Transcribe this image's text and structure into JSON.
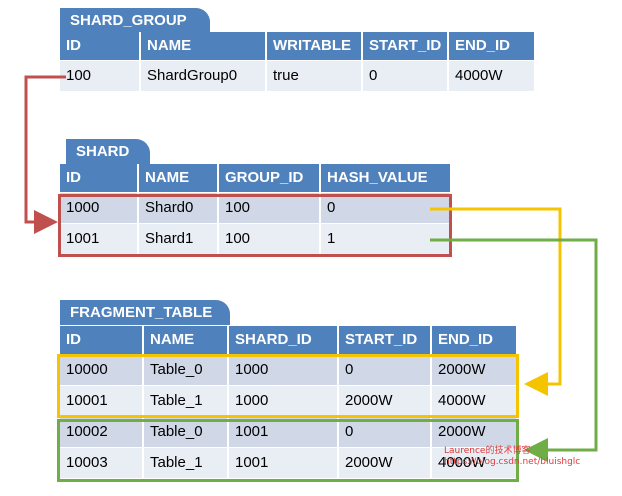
{
  "colors": {
    "header_blue": "#4f81bd",
    "row_dark": "#d0d8e8",
    "row_light": "#e9edf4",
    "red_link": "#c0504d",
    "yellow_link": "#f5c400",
    "green_link": "#70ad47"
  },
  "shard_group": {
    "title": "SHARD_GROUP",
    "columns": [
      "ID",
      "NAME",
      "WRITABLE",
      "START_ID",
      "END_ID"
    ],
    "rows": [
      [
        "100",
        "ShardGroup0",
        "true",
        "0",
        "4000W"
      ]
    ]
  },
  "shard": {
    "title": "SHARD",
    "columns": [
      "ID",
      "NAME",
      "GROUP_ID",
      "HASH_VALUE"
    ],
    "rows": [
      [
        "1000",
        "Shard0",
        "100",
        "0"
      ],
      [
        "1001",
        "Shard1",
        "100",
        "1"
      ]
    ]
  },
  "fragment_table": {
    "title": "FRAGMENT_TABLE",
    "columns": [
      "ID",
      "NAME",
      "SHARD_ID",
      "START_ID",
      "END_ID"
    ],
    "rows": [
      [
        "10000",
        "Table_0",
        "1000",
        "0",
        "2000W"
      ],
      [
        "10001",
        "Table_1",
        "1000",
        "2000W",
        "4000W"
      ],
      [
        "10002",
        "Table_0",
        "1001",
        "0",
        "2000W"
      ],
      [
        "10003",
        "Table_1",
        "1001",
        "2000W",
        "4000W"
      ]
    ]
  },
  "watermark": {
    "line1": "Laurence的技术博客",
    "line2": "https://blog.csdn.net/bluishglc"
  }
}
